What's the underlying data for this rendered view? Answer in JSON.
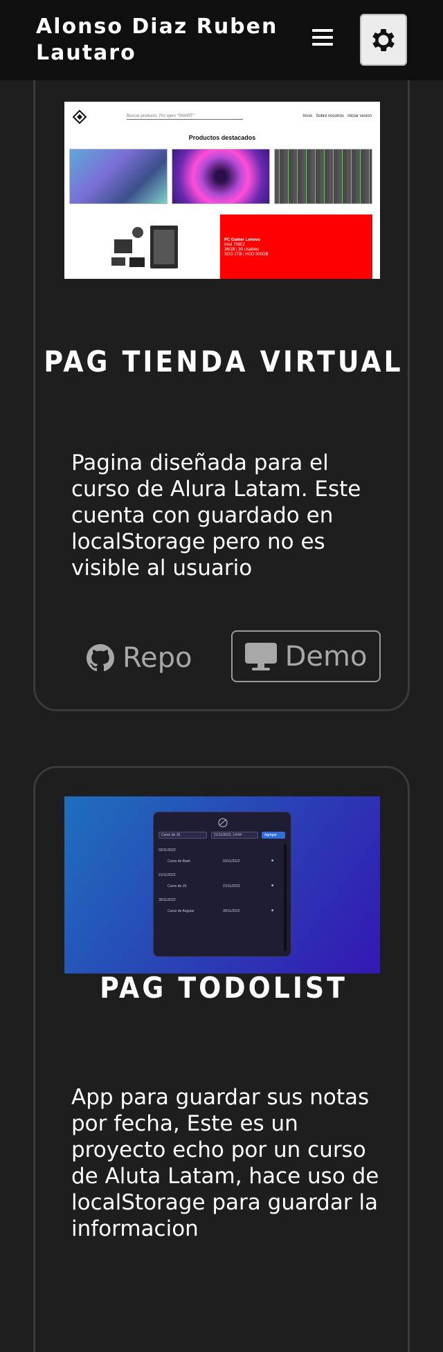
{
  "header": {
    "brand": "Alonso Diaz Ruben Lautaro",
    "menu_icon": "hamburger-menu-icon",
    "theme_icon": "gear-icon"
  },
  "projects": [
    {
      "title": "PAG TIENDA VIRTUAL",
      "description": "Pagina diseñada para el curso de Alura Latam. Este cuenta con guardado en localStorage pero no es visible al usuario",
      "repo_label": "Repo",
      "demo_label": "Demo",
      "preview": {
        "search_placeholder": "Buscar producto. Por ejem \"SMART\"",
        "nav_home": "Inicio",
        "nav_about": "Sobre nosotros",
        "nav_login": "Iniciar sesion",
        "heading": "Productos destacados",
        "promo_title": "PC Gamer Lenovo",
        "promo_line1": "Intel 7990Z",
        "promo_line2": "36GB | 30 Usables",
        "promo_line3": "SDD 1TB | HDD 500GB"
      }
    },
    {
      "title": "PAG TODOLIST",
      "description": "App para guardar sus notas por fecha, Este es un proyecto echo por un curso de Aluta Latam, hace uso de localStorage para guardar la informacion",
      "preview": {
        "input_text": "Curso de JS",
        "date_text": "21/11/2022, 14:04",
        "add_label": "Agregar",
        "groups": [
          {
            "date": "03/11/2022",
            "task": "Curso de Bash",
            "task_date": "03/11/2022"
          },
          {
            "date": "21/11/2022",
            "task": "Curso de JS",
            "task_date": "21/11/2022"
          },
          {
            "date": "30/11/2022",
            "task": "Curso de Angular",
            "task_date": "30/11/2022"
          }
        ]
      }
    }
  ],
  "colors": {
    "background": "#1e1e1e",
    "header": "#0f0f0f",
    "card_border": "#3a3a3a",
    "muted": "#a8a8a8",
    "promo_red": "#ff0000"
  }
}
